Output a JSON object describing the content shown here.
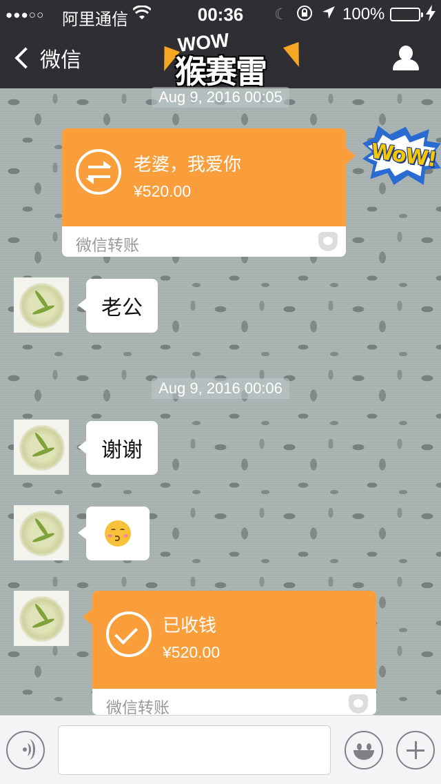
{
  "status_bar": {
    "signal": "●●●○○",
    "carrier": "阿里通信",
    "time": "00:36",
    "battery": "100%",
    "battery_level": 1.0
  },
  "nav": {
    "back_label": "微信",
    "logo_small": "WOW",
    "logo_big": "猴赛雷"
  },
  "messages": {
    "timestamp_1": "Aug 9, 2016 00:05",
    "transfer_1": {
      "title": "老婆，我爱你",
      "amount": "¥520.00",
      "label": "微信转账"
    },
    "sticker_text": "WoW!",
    "text_1": "老公",
    "timestamp_2": "Aug 9, 2016 00:06",
    "text_2": "谢谢",
    "emoji_name": "kissing-face",
    "transfer_2": {
      "title": "已收钱",
      "amount": "¥520.00",
      "label": "微信转账"
    }
  },
  "input": {
    "value": ""
  },
  "colors": {
    "bar": "#2e2e33",
    "transfer_orange": "#f99e3b",
    "battery_green": "#4cd964"
  },
  "icons": [
    "back-chevron-icon",
    "profile-icon",
    "swap-arrows-icon",
    "checkmark-icon",
    "shield-icon",
    "voice-icon",
    "emoji-icon",
    "plus-icon",
    "wifi-icon",
    "moon-icon",
    "orientation-lock-icon",
    "location-icon",
    "charging-icon"
  ]
}
